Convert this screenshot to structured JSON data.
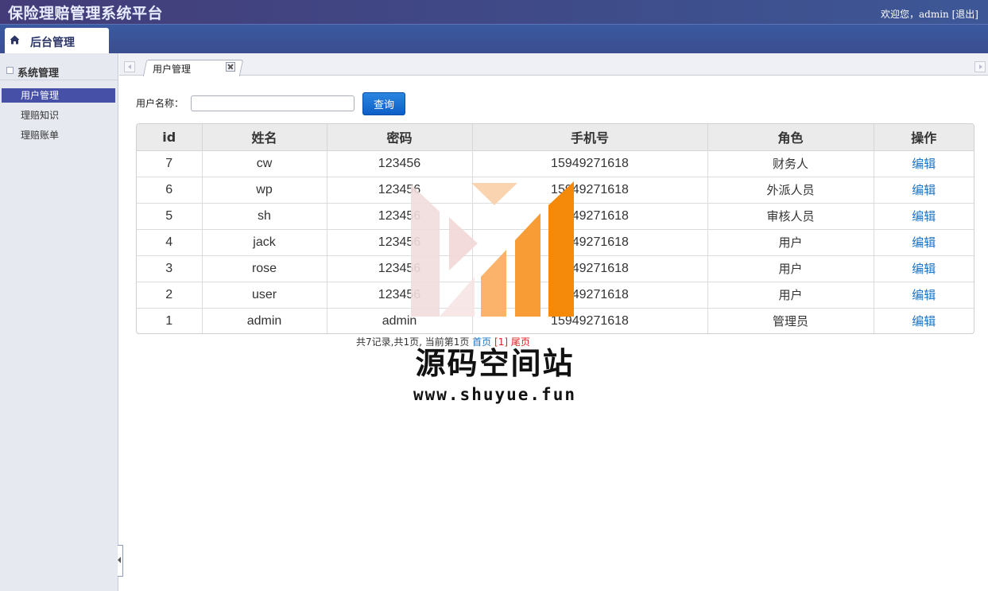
{
  "header": {
    "app_title": "保险理赔管理系统平台",
    "welcome_prefix": "欢迎您，admin",
    "logout_label": "[退出]"
  },
  "navbar": {
    "tab_label": "后台管理",
    "tab_icon": "home-icon"
  },
  "sidebar": {
    "section_title": "系统管理",
    "items": [
      {
        "label": "用户管理",
        "active": true
      },
      {
        "label": "理赔知识",
        "active": false
      },
      {
        "label": "理赔账单",
        "active": false
      }
    ]
  },
  "tabs": {
    "active_tab": "用户管理"
  },
  "search": {
    "label": "用户名称：",
    "value": "",
    "placeholder": "",
    "button_label": "查询"
  },
  "table": {
    "columns": [
      "id",
      "姓名",
      "密码",
      "手机号",
      "角色",
      "操作"
    ],
    "rows": [
      {
        "id": "7",
        "name": "cw",
        "password": "123456",
        "phone": "15949271618",
        "role": "财务人",
        "action": "编辑"
      },
      {
        "id": "6",
        "name": "wp",
        "password": "123456",
        "phone": "15949271618",
        "role": "外派人员",
        "action": "编辑"
      },
      {
        "id": "5",
        "name": "sh",
        "password": "123456",
        "phone": "15949271618",
        "role": "审核人员",
        "action": "编辑"
      },
      {
        "id": "4",
        "name": "jack",
        "password": "123456",
        "phone": "15949271618",
        "role": "用户",
        "action": "编辑"
      },
      {
        "id": "3",
        "name": "rose",
        "password": "123456",
        "phone": "15949271618",
        "role": "用户",
        "action": "编辑"
      },
      {
        "id": "2",
        "name": "user",
        "password": "123456",
        "phone": "15949271618",
        "role": "用户",
        "action": "编辑"
      },
      {
        "id": "1",
        "name": "admin",
        "password": "admin",
        "phone": "15949271618",
        "role": "管理员",
        "action": "编辑"
      }
    ]
  },
  "pager": {
    "summary": "共7记录,共1页, 当前第1页 ",
    "first_label": "首页",
    "current_label": "[1]",
    "last_label": "尾页"
  },
  "watermark": {
    "title": "源码空间站",
    "url": "www.shuyue.fun"
  },
  "colors": {
    "header_bg": "#433c78",
    "active_item_bg": "#4650a7",
    "button_bg": "#0d5fc7",
    "link": "#1a73c4",
    "pager_red": "#e02020",
    "watermark_orange": "#f5890a"
  }
}
